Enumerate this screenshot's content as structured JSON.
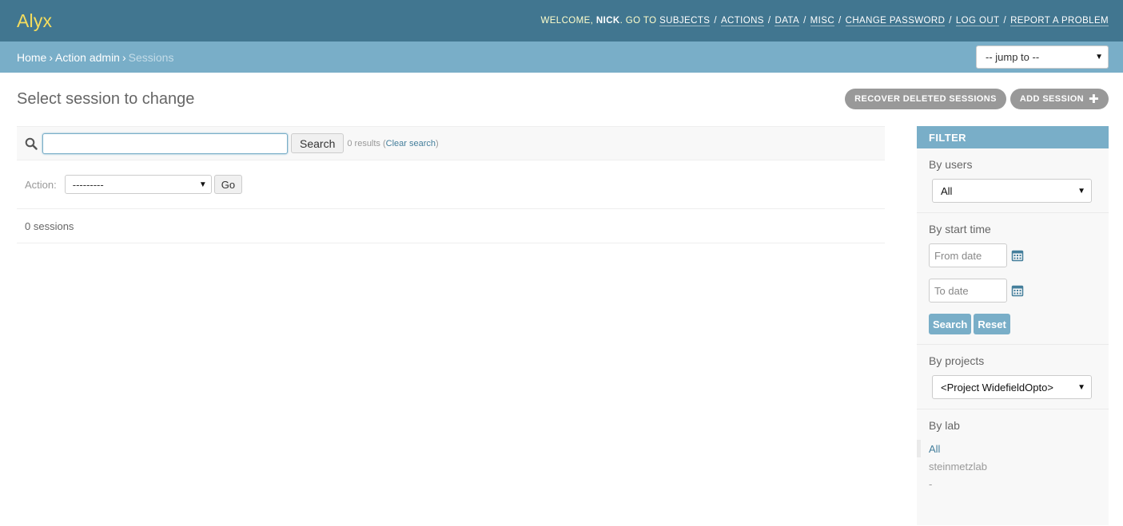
{
  "header": {
    "brand": "Alyx",
    "welcome": "WELCOME,",
    "username": "NICK",
    "goto": ". GO TO",
    "links": [
      {
        "label": "SUBJECTS"
      },
      {
        "label": "ACTIONS"
      },
      {
        "label": "DATA"
      },
      {
        "label": "MISC"
      },
      {
        "label": "CHANGE PASSWORD"
      },
      {
        "label": "LOG OUT"
      },
      {
        "label": "REPORT A PROBLEM"
      }
    ]
  },
  "breadcrumbs": {
    "home": "Home",
    "section": "Action admin",
    "current": "Sessions",
    "separator": "›",
    "jump_to": "-- jump to --"
  },
  "page": {
    "title": "Select session to change",
    "recover_button": "RECOVER DELETED SESSIONS",
    "add_button": "ADD SESSION",
    "add_icon": "plus-icon"
  },
  "search": {
    "value": "",
    "button": "Search",
    "results_text": "0 results (",
    "clear_link": "Clear search",
    "results_end": ")"
  },
  "actions": {
    "label": "Action:",
    "selected": "---------",
    "go_button": "Go"
  },
  "paginator": {
    "count_text": "0 sessions"
  },
  "filter": {
    "title": "FILTER",
    "by_users": {
      "title": "By users",
      "selected": "All"
    },
    "by_start_time": {
      "title": "By start time",
      "from_placeholder": "From date",
      "to_placeholder": "To date",
      "search_button": "Search",
      "reset_button": "Reset"
    },
    "by_projects": {
      "title": "By projects",
      "selected": "<Project WidefieldOpto>"
    },
    "by_lab": {
      "title": "By lab",
      "options": [
        {
          "label": "All",
          "selected": true
        },
        {
          "label": "steinmetzlab",
          "selected": false
        },
        {
          "label": "-",
          "selected": false
        }
      ]
    }
  },
  "colors": {
    "header_bg": "#417690",
    "brand": "#f5dd5d",
    "breadcrumb_bg": "#79aec8",
    "button_grey": "#999999",
    "link": "#447e9b"
  }
}
